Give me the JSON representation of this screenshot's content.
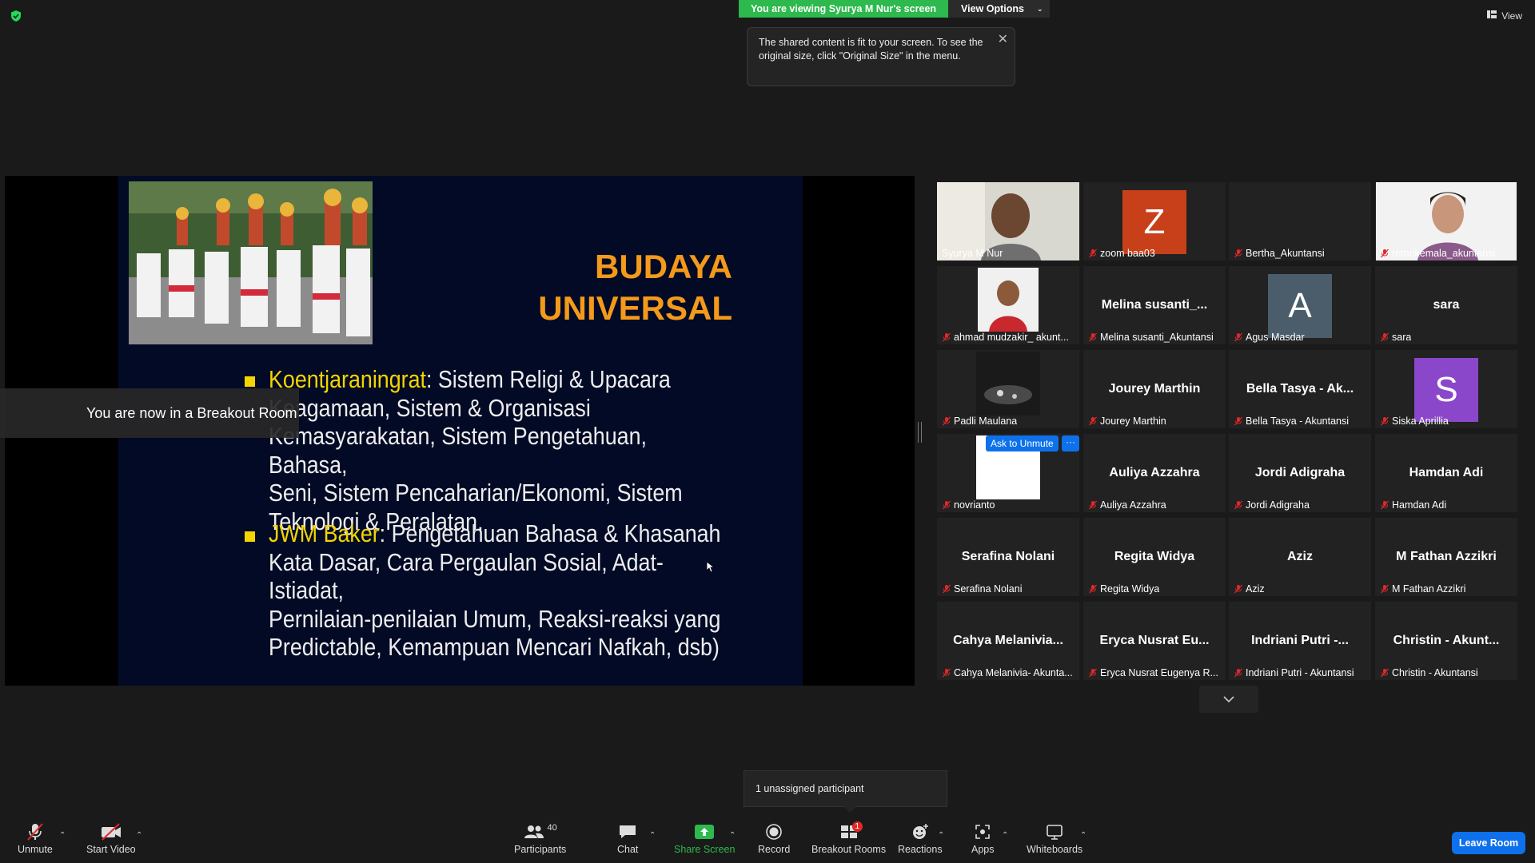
{
  "top": {
    "viewing_banner": "You are viewing Syurya M Nur's screen",
    "view_options": "View Options",
    "view_right": "View",
    "tooltip": "The shared content is fit to your screen. To see the original size, click \"Original Size\" in the menu."
  },
  "slide": {
    "title_line1": "BUDAYA",
    "title_line2": "UNIVERSAL",
    "bullet1_head": "Koentjaraningrat",
    "bullet1_lines": [
      ": Sistem Religi & Upacara",
      "Keagamaan, Sistem & Organisasi",
      "Kemasyarakatan, Sistem Pengetahuan, Bahasa,",
      "Seni, Sistem Pencaharian/Ekonomi, Sistem",
      "Teknologi & Peralatan."
    ],
    "bullet2_head": "JWM Baker",
    "bullet2_lines": [
      ": Pengetahuan Bahasa & Khasanah",
      "Kata Dasar, Cara Pergaulan Sosial, Adat-Istiadat,",
      "Pernilaian-penilaian Umum, Reaksi-reaksi yang",
      "Predictable, Kemampuan Mencari Nafkah, dsb)"
    ]
  },
  "breakout_toast": "You are now in a Breakout Room",
  "gallery": {
    "ask_to_unmute": "Ask to Unmute",
    "more": "···",
    "tiles": [
      {
        "name": "Syurya M Nur",
        "center": "",
        "avatar": "",
        "kind": "video"
      },
      {
        "name": "zoom baa03",
        "center": "",
        "avatar": "Z",
        "avatar_color": "#c8401a",
        "kind": "avatar"
      },
      {
        "name": "Bertha_Akuntansi",
        "center": "",
        "avatar": "",
        "kind": "blank"
      },
      {
        "name": "retnokemala_akuntansi",
        "center": "",
        "avatar": "",
        "kind": "video"
      },
      {
        "name": "ahmad mudzakir_ akunt...",
        "center": "",
        "avatar": "",
        "kind": "video"
      },
      {
        "name": "Melina susanti_Akuntansi",
        "center": "Melina  susanti_...",
        "avatar": "",
        "kind": "text"
      },
      {
        "name": "Agus Masdar",
        "center": "",
        "avatar": "A",
        "avatar_color": "#4b5d6b",
        "kind": "avatar"
      },
      {
        "name": "sara",
        "center": "sara",
        "avatar": "",
        "kind": "text"
      },
      {
        "name": "Padli Maulana",
        "center": "",
        "avatar": "",
        "kind": "video"
      },
      {
        "name": "Jourey Marthin",
        "center": "Jourey Marthin",
        "avatar": "",
        "kind": "text"
      },
      {
        "name": "Bella Tasya - Akuntansi",
        "center": "Bella Tasya - Ak...",
        "avatar": "",
        "kind": "text"
      },
      {
        "name": "Siska Aprillia",
        "center": "",
        "avatar": "S",
        "avatar_color": "#8a47c9",
        "kind": "avatar"
      },
      {
        "name": "novrianto",
        "center": "",
        "avatar": "",
        "kind": "video"
      },
      {
        "name": "Auliya Azzahra",
        "center": "Auliya Azzahra",
        "avatar": "",
        "kind": "text"
      },
      {
        "name": "Jordi Adigraha",
        "center": "Jordi Adigraha",
        "avatar": "",
        "kind": "text"
      },
      {
        "name": "Hamdan Adi",
        "center": "Hamdan Adi",
        "avatar": "",
        "kind": "text"
      },
      {
        "name": "Serafina Nolani",
        "center": "Serafina Nolani",
        "avatar": "",
        "kind": "text"
      },
      {
        "name": "Regita Widya",
        "center": "Regita Widya",
        "avatar": "",
        "kind": "text"
      },
      {
        "name": "Aziz",
        "center": "Aziz",
        "avatar": "",
        "kind": "text"
      },
      {
        "name": "M Fathan Azzikri",
        "center": "M Fathan Azzikri",
        "avatar": "",
        "kind": "text"
      },
      {
        "name": "Cahya Melanivia- Akunta...",
        "center": "Cahya  Melanivia...",
        "avatar": "",
        "kind": "text"
      },
      {
        "name": "Eryca Nusrat Eugenya R...",
        "center": "Eryca Nusrat Eu...",
        "avatar": "",
        "kind": "text"
      },
      {
        "name": "Indriani Putri - Akuntansi",
        "center": "Indriani  Putri -...",
        "avatar": "",
        "kind": "text"
      },
      {
        "name": "Christin  - Akuntansi",
        "center": "Christin  - Akunt...",
        "avatar": "",
        "kind": "text"
      }
    ]
  },
  "unassigned": "1 unassigned participant",
  "toolbar": {
    "unmute": "Unmute",
    "start_video": "Start Video",
    "participants": "Participants",
    "participants_count": "40",
    "chat": "Chat",
    "share_screen": "Share Screen",
    "record": "Record",
    "breakout_rooms": "Breakout Rooms",
    "breakout_badge": "1",
    "reactions": "Reactions",
    "apps": "Apps",
    "whiteboards": "Whiteboards",
    "leave_room": "Leave Room"
  },
  "colors": {
    "accent_green": "#2db94d",
    "accent_blue": "#0e71eb",
    "active_speaker": "#d4e44e",
    "slide_title": "#f39a1b",
    "slide_highlight": "#f3d500"
  }
}
